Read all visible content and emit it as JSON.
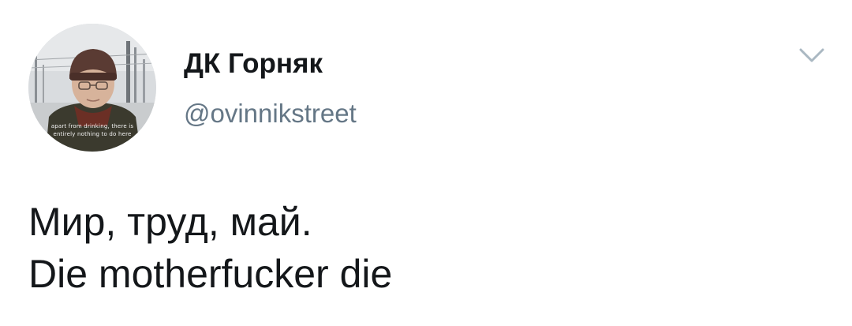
{
  "author": {
    "display_name": "ДК Горняк",
    "handle": "@ovinnikstreet",
    "avatar_caption_line1": "apart from drinking, there is",
    "avatar_caption_line2": "entirely nothing to do here"
  },
  "tweet": {
    "lines": [
      "Мир, труд, май.",
      "Die motherfucker die"
    ]
  },
  "icons": {
    "menu": "chevron-down-icon"
  },
  "colors": {
    "text": "#14171a",
    "secondary": "#657786",
    "chevron": "#aab8c2",
    "background": "#ffffff"
  }
}
